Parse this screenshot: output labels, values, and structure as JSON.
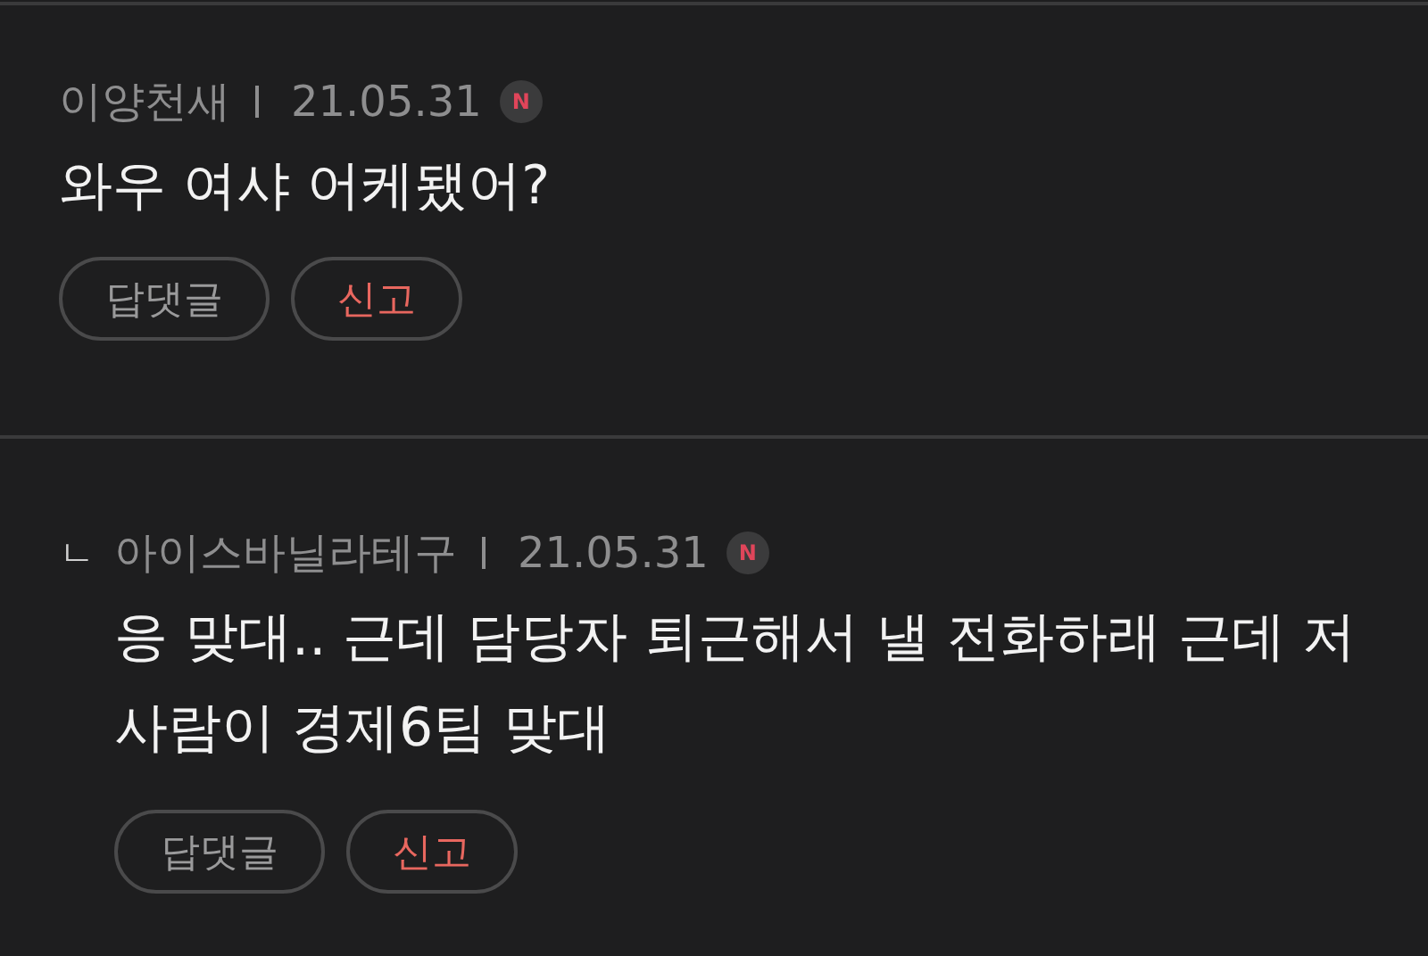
{
  "comments": [
    {
      "kind": "comment",
      "author": "이양천새",
      "date": "21.05.31",
      "badge": "N",
      "body": "와우 여샤 어케됐어?",
      "buttons": [
        {
          "label": "답댓글",
          "kind": "reply"
        },
        {
          "label": "신고",
          "kind": "report"
        }
      ]
    },
    {
      "kind": "reply",
      "reply_mark": "ㄴ",
      "author": "아이스바닐라테구",
      "date": "21.05.31",
      "badge": "N",
      "body": "응 맞대.. 근데 담당자 퇴근해서 낼 전화하래 근데 저사람이 경제6팀 맞대",
      "buttons": [
        {
          "label": "답댓글",
          "kind": "reply"
        },
        {
          "label": "신고",
          "kind": "report"
        }
      ]
    }
  ]
}
